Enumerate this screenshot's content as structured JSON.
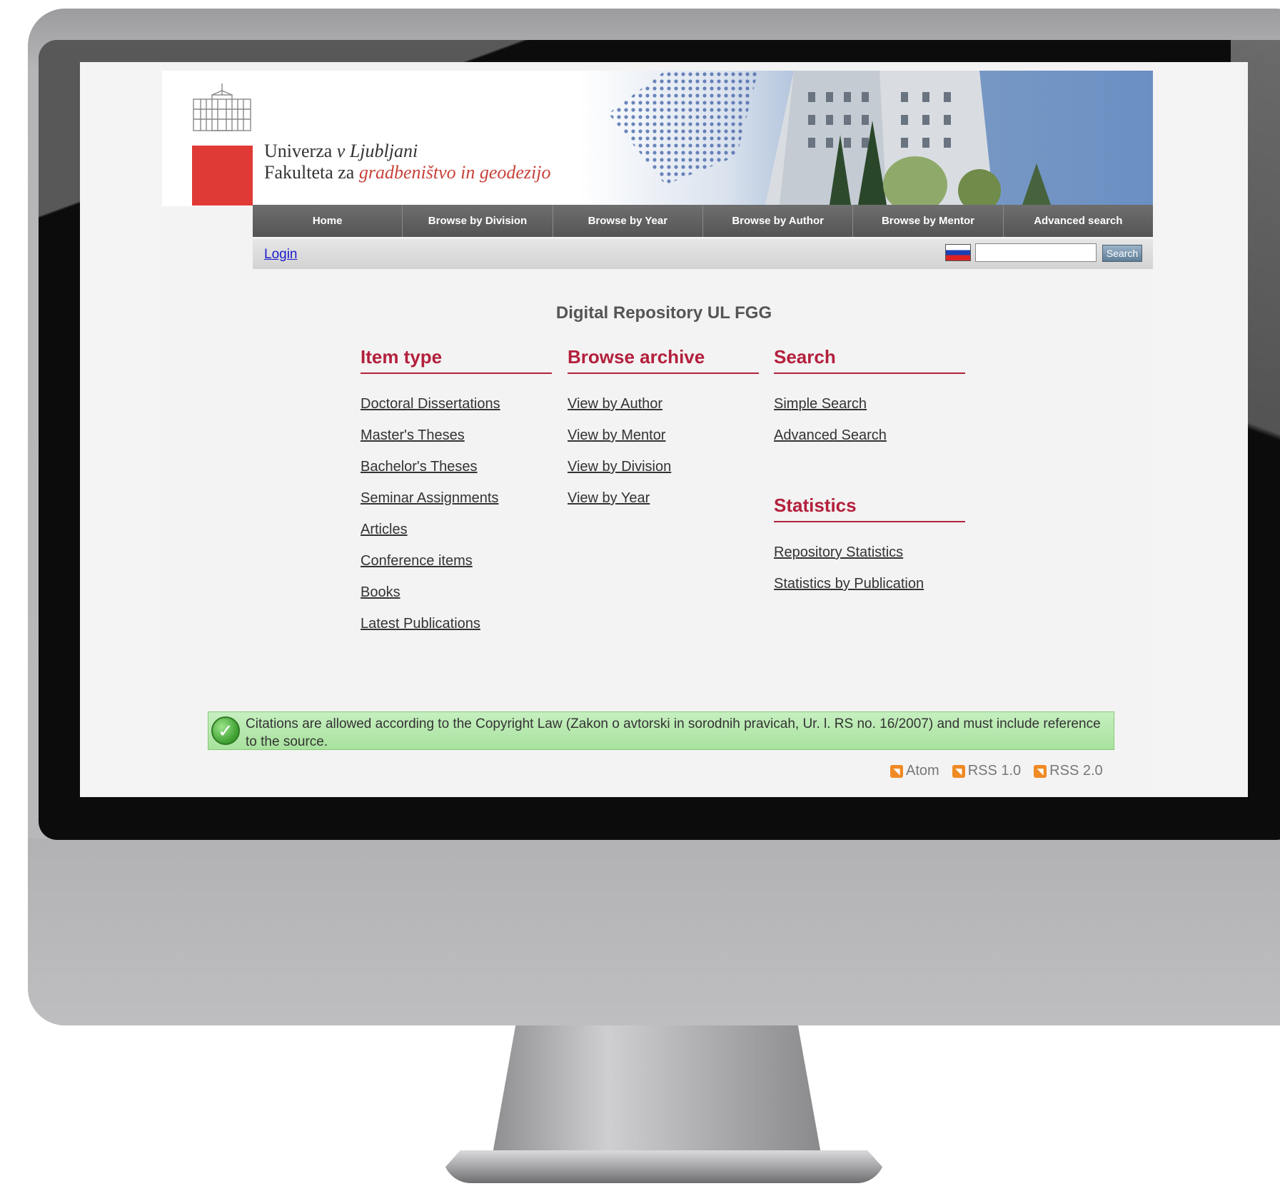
{
  "header": {
    "line1_a": "Univerza ",
    "line1_b": "v",
    "line1_c": " Ljubljani",
    "line2_a": "Fakulteta za ",
    "line2_b": "gradbeništvo in geodezijo"
  },
  "nav": [
    "Home",
    "Browse by Division",
    "Browse by Year",
    "Browse by Author",
    "Browse by Mentor",
    "Advanced search"
  ],
  "login_bar": {
    "login": "Login",
    "search_button": "Search",
    "search_value": ""
  },
  "title": "Digital Repository UL FGG",
  "columns": {
    "item_type": {
      "heading": "Item type",
      "links": [
        "Doctoral Dissertations",
        "Master's Theses",
        "Bachelor's Theses",
        "Seminar Assignments",
        "Articles",
        "Conference items",
        "Books",
        "Latest Publications"
      ]
    },
    "browse": {
      "heading": "Browse archive",
      "links": [
        "View by Author",
        "View by Mentor",
        "View by Division",
        "View by Year"
      ]
    },
    "search": {
      "heading": "Search",
      "links": [
        "Simple Search",
        "Advanced Search"
      ]
    },
    "statistics": {
      "heading": "Statistics",
      "links": [
        "Repository Statistics",
        "Statistics by Publication"
      ]
    }
  },
  "citation": "Citations are allowed according to the Copyright Law (Zakon o avtorski in sorodnih pravicah, Ur. l. RS no. 16/2007) and must include reference to the source.",
  "feeds": [
    "Atom",
    "RSS 1.0",
    "RSS 2.0"
  ],
  "colors": {
    "accent": "#b3203c",
    "logo_red": "#e03a36",
    "nav_bg": "#5f5f5f",
    "citation_bg": "#b7e8ad"
  },
  "icons": [
    "university-building-icon",
    "slovenian-flag-icon",
    "check-icon",
    "rss-icon"
  ]
}
